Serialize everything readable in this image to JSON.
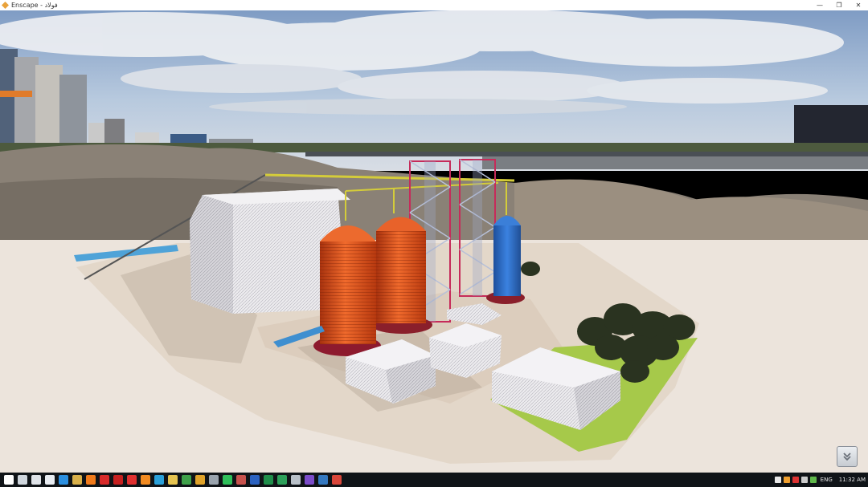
{
  "window": {
    "title": "Enscape - فولاد",
    "minimize": "—",
    "restore": "❐",
    "close": "✕"
  },
  "colors": {
    "sky": "#9bb6d8",
    "ground": "#ece4dc",
    "silo_orange": "#e2531f",
    "silo_blue": "#2f6fcf",
    "grass": "#a6c94a",
    "taskbar": "#101418"
  },
  "viewer": {
    "nav_icon": "double-chevron-down-icon"
  },
  "taskbar": {
    "apps": [
      {
        "name": "start-icon",
        "color": "#ffffff"
      },
      {
        "name": "task-view-icon",
        "color": "#cfd6dd"
      },
      {
        "name": "store-icon",
        "color": "#dfe3e8"
      },
      {
        "name": "mail-icon",
        "color": "#e9edf2"
      },
      {
        "name": "edge-icon",
        "color": "#2b8fe0"
      },
      {
        "name": "explorer-icon",
        "color": "#d8b04a"
      },
      {
        "name": "firefox-icon",
        "color": "#f07a1b"
      },
      {
        "name": "autocad-icon",
        "color": "#d82a2a"
      },
      {
        "name": "autocad-alt-icon",
        "color": "#c62020"
      },
      {
        "name": "acrobat-icon",
        "color": "#e03030"
      },
      {
        "name": "search-app-icon",
        "color": "#f28b22"
      },
      {
        "name": "telegram-icon",
        "color": "#2aa0d9"
      },
      {
        "name": "files-icon",
        "color": "#e5c350"
      },
      {
        "name": "chrome-icon",
        "color": "#3fa14a"
      },
      {
        "name": "vpn-icon",
        "color": "#e0a32a"
      },
      {
        "name": "settings-icon",
        "color": "#9aa4ae"
      },
      {
        "name": "whatsapp-icon",
        "color": "#2fbf5a"
      },
      {
        "name": "sketchup-icon",
        "color": "#c7524d"
      },
      {
        "name": "word-icon",
        "color": "#2b62c0"
      },
      {
        "name": "excel-icon",
        "color": "#1f8e4a"
      },
      {
        "name": "excel-alt-icon",
        "color": "#2da05a"
      },
      {
        "name": "calculator-icon",
        "color": "#b8c0c8"
      },
      {
        "name": "visual-studio-icon",
        "color": "#7b4cc9"
      },
      {
        "name": "photoshop-icon",
        "color": "#3478c0"
      },
      {
        "name": "enscape-icon",
        "color": "#d9463a"
      }
    ],
    "tray": {
      "language": "ENG",
      "time": "11:32 AM"
    }
  }
}
